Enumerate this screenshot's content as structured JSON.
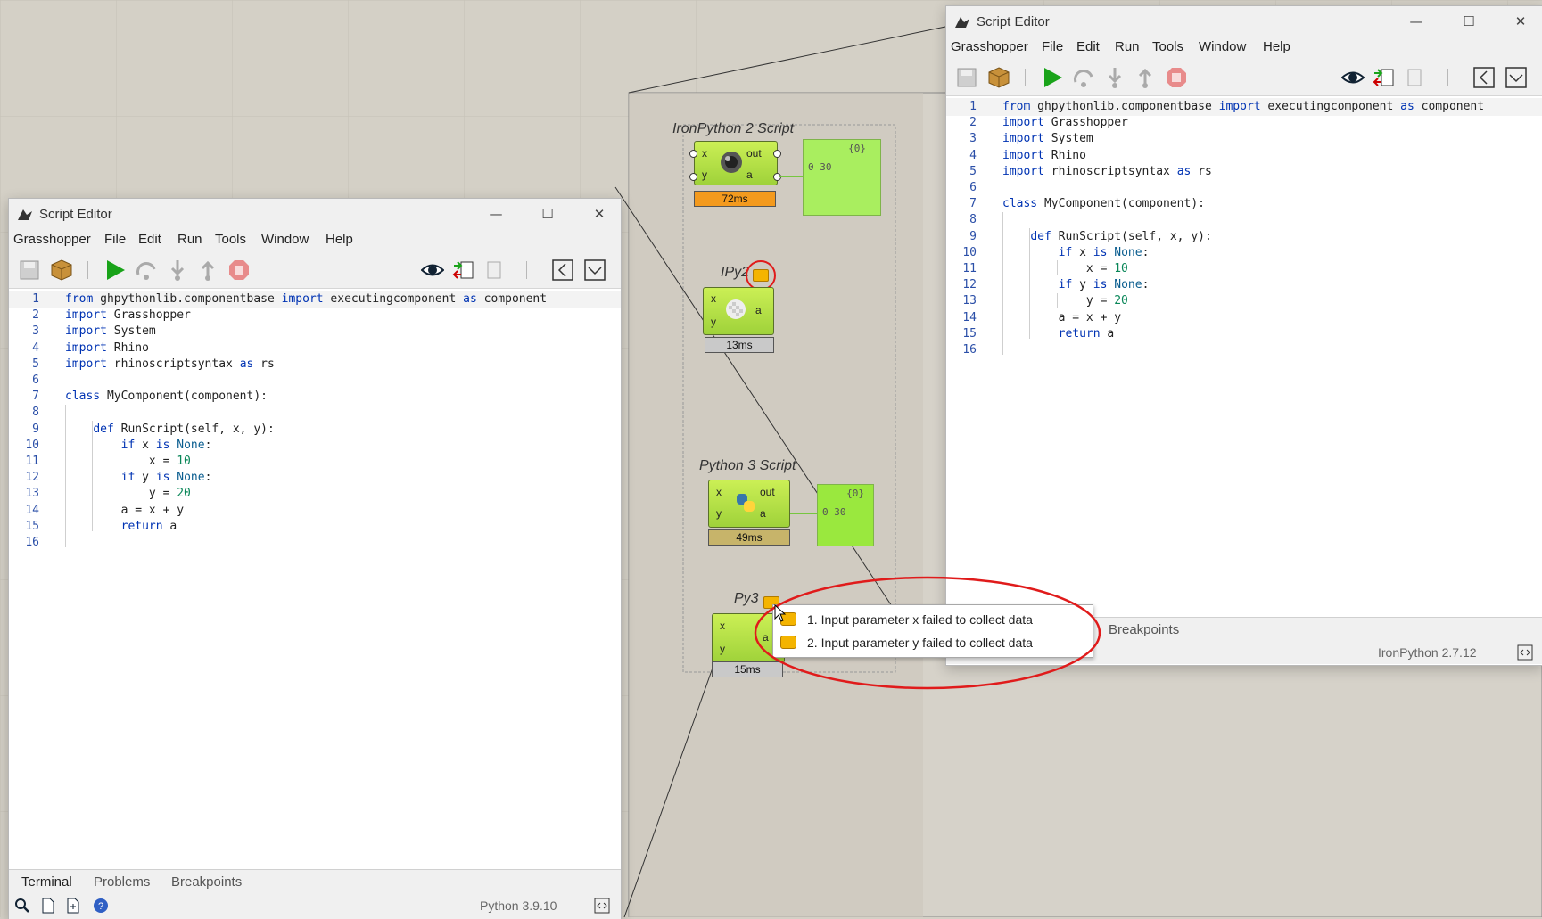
{
  "left_editor": {
    "title": "Script Editor",
    "window_controls": {
      "minimize": "—",
      "maximize": "☐",
      "close": "✕"
    },
    "menu": [
      "Grasshopper",
      "File",
      "Edit",
      "Run",
      "Tools",
      "Window",
      "Help"
    ],
    "bottom_tabs": [
      "Terminal",
      "Problems",
      "Breakpoints"
    ],
    "status_version": "Python 3.9.10"
  },
  "right_editor": {
    "title": "Script Editor",
    "window_controls": {
      "minimize": "—",
      "maximize": "☐",
      "close": "✕"
    },
    "menu": [
      "Grasshopper",
      "File",
      "Edit",
      "Run",
      "Tools",
      "Window",
      "Help"
    ],
    "bottom_tab_visible": "Breakpoints",
    "status_version": "IronPython 2.7.12"
  },
  "code_lines": [
    {
      "n": "1",
      "text": "from ghpythonlib.componentbase import executingcomponent as component"
    },
    {
      "n": "2",
      "text": "import Grasshopper"
    },
    {
      "n": "3",
      "text": "import System"
    },
    {
      "n": "4",
      "text": "import Rhino"
    },
    {
      "n": "5",
      "text": "import rhinoscriptsyntax as rs"
    },
    {
      "n": "6",
      "text": ""
    },
    {
      "n": "7",
      "text": "class MyComponent(component):"
    },
    {
      "n": "8",
      "text": ""
    },
    {
      "n": "9",
      "text": "    def RunScript(self, x, y):"
    },
    {
      "n": "10",
      "text": "        if x is None:"
    },
    {
      "n": "11",
      "text": "            x = 10"
    },
    {
      "n": "12",
      "text": "        if y is None:"
    },
    {
      "n": "13",
      "text": "            y = 20"
    },
    {
      "n": "14",
      "text": "        a = x + y"
    },
    {
      "n": "15",
      "text": "        return a"
    },
    {
      "n": "16",
      "text": ""
    }
  ],
  "canvas": {
    "ironpython2": {
      "label": "IronPython 2 Script",
      "in_x": "x",
      "in_y": "y",
      "out": "out",
      "out_a": "a",
      "timing": "72ms",
      "panel_header": "{0}",
      "panel_value": "0  30"
    },
    "ipy2": {
      "label": "IPy2",
      "in_x": "x",
      "in_y": "y",
      "out_a": "a",
      "timing": "13ms"
    },
    "python3": {
      "label": "Python 3 Script",
      "in_x": "x",
      "in_y": "y",
      "out": "out",
      "out_a": "a",
      "timing": "49ms",
      "panel_header": "{0}",
      "panel_value": "0  30"
    },
    "py3": {
      "label": "Py3",
      "in_x": "x",
      "in_y": "y",
      "out_a": "a",
      "timing": "15ms"
    }
  },
  "tooltip": {
    "items": [
      "1. Input parameter x failed to collect data",
      "2. Input parameter y failed to collect data"
    ]
  },
  "colors": {
    "component_green": "#b8e84a",
    "panel_green": "#a9ee5f",
    "timing_orange": "#f39a1e",
    "timing_tan": "#c7b46a",
    "timing_gray": "#c9c9c9",
    "annotation_red": "#e01b1b",
    "warning_bubble": "#f4b400"
  }
}
